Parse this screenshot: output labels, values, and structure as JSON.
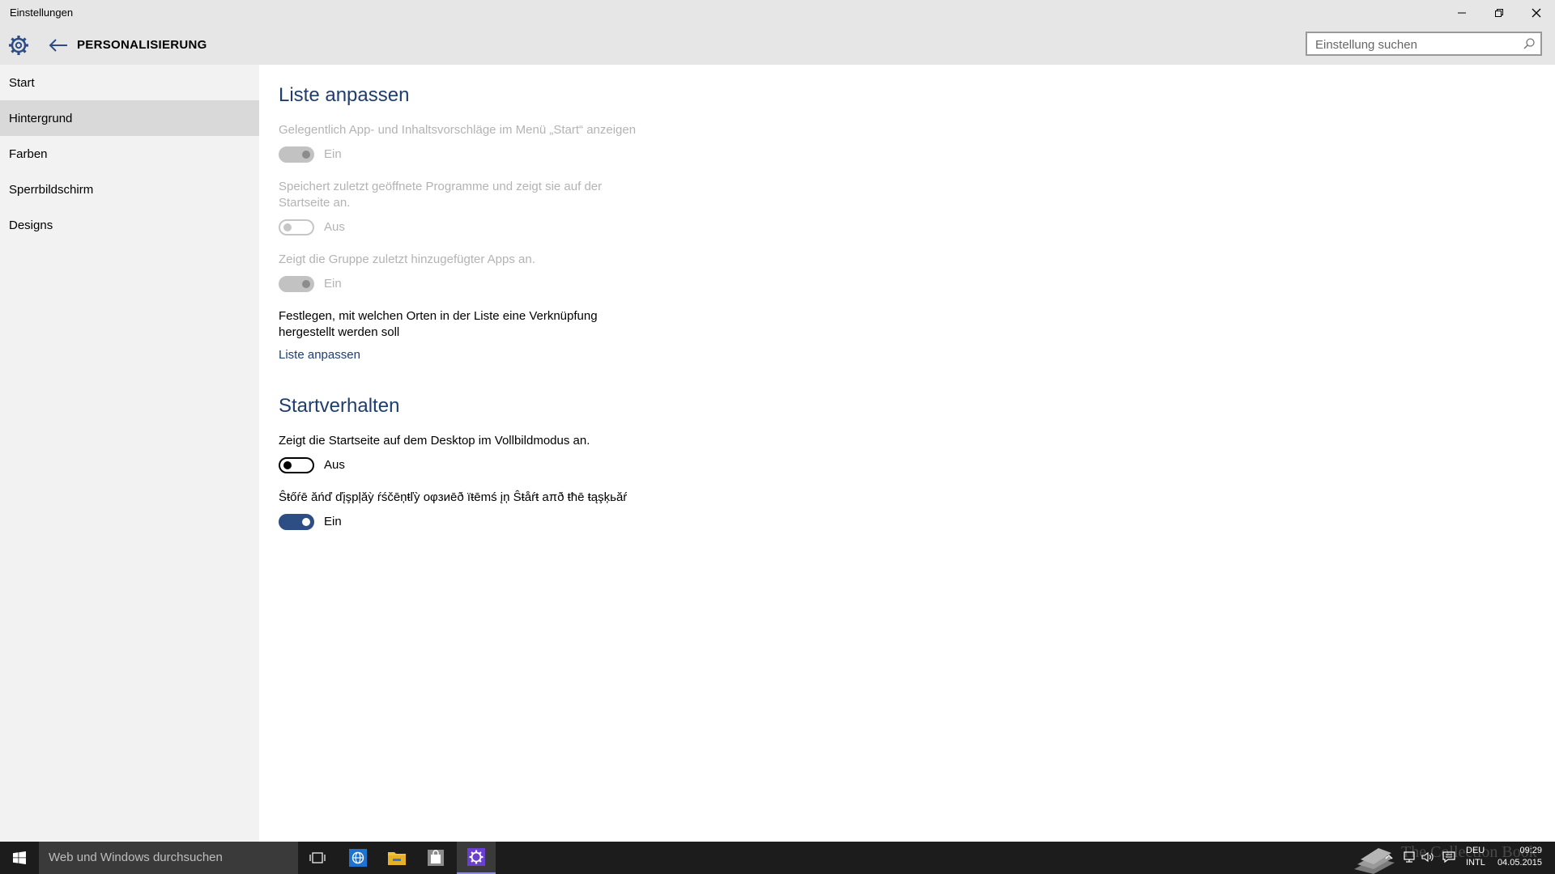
{
  "window": {
    "title": "Einstellungen"
  },
  "header": {
    "section_title": "PERSONALISIERUNG",
    "search_placeholder": "Einstellung suchen"
  },
  "sidebar": {
    "items": [
      {
        "label": "Start"
      },
      {
        "label": "Hintergrund"
      },
      {
        "label": "Farben"
      },
      {
        "label": "Sperrbildschirm"
      },
      {
        "label": "Designs"
      }
    ]
  },
  "main": {
    "liste": {
      "heading": "Liste anpassen",
      "settings": [
        {
          "description": "Gelegentlich App- und Inhaltsvorschläge im Menü „Start“ anzeigen",
          "state": "Ein",
          "enabled": false
        },
        {
          "description": "Speichert zuletzt geöffnete Programme und zeigt sie auf der Startseite an.",
          "state": "Aus",
          "enabled": false
        },
        {
          "description": "Zeigt die Gruppe zuletzt hinzugefügter Apps an.",
          "state": "Ein",
          "enabled": false
        }
      ],
      "pin_description": "Festlegen, mit welchen Orten in der Liste eine Verknüpfung hergestellt werden soll",
      "pin_link": "Liste anpassen"
    },
    "startverhalten": {
      "heading": "Startverhalten",
      "settings": [
        {
          "description": "Zeigt die Startseite auf dem Desktop im Vollbildmodus an.",
          "state": "Aus",
          "enabled": true
        },
        {
          "description": "Ŝŧőŕē ăńď ďįşpļăỳ ŕśčēņŧľỳ oφзиēð ïŧēmś įņ Ŝŧåŕŧ aπð ŧħē ŧąşķьăŕ",
          "state": "Ein",
          "enabled": true
        }
      ]
    }
  },
  "taskbar": {
    "search_placeholder": "Web und Windows durchsuchen",
    "watermark": "The Collection Book",
    "lang_top": "DEU",
    "lang_bottom": "INTL",
    "time": "09:29",
    "date": "04.05.2015"
  },
  "icons": {
    "settings": "gear-icon",
    "back": "back-arrow-icon",
    "search": "search-icon",
    "minimize": "minimize-icon",
    "maximize": "restore-icon",
    "close": "close-icon"
  },
  "colors": {
    "accent": "#2d4e84",
    "heading": "#1f3d6e",
    "sidebar_bg": "#f2f2f2",
    "titlebar_bg": "#e6e6e6",
    "taskbar_bg": "#1c1c1c"
  }
}
